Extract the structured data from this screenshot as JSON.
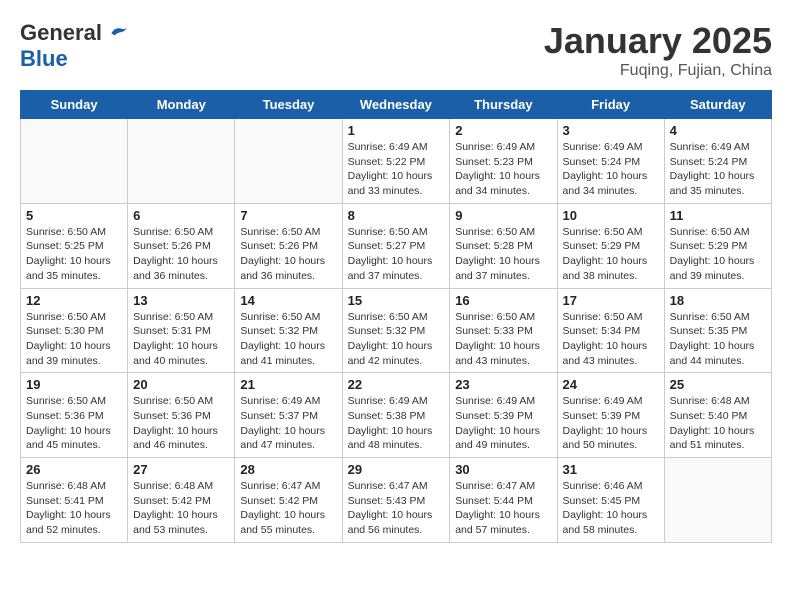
{
  "header": {
    "logo_general": "General",
    "logo_blue": "Blue",
    "title": "January 2025",
    "subtitle": "Fuqing, Fujian, China"
  },
  "weekdays": [
    "Sunday",
    "Monday",
    "Tuesday",
    "Wednesday",
    "Thursday",
    "Friday",
    "Saturday"
  ],
  "weeks": [
    [
      {
        "day": "",
        "info": ""
      },
      {
        "day": "",
        "info": ""
      },
      {
        "day": "",
        "info": ""
      },
      {
        "day": "1",
        "info": "Sunrise: 6:49 AM\nSunset: 5:22 PM\nDaylight: 10 hours and 33 minutes."
      },
      {
        "day": "2",
        "info": "Sunrise: 6:49 AM\nSunset: 5:23 PM\nDaylight: 10 hours and 34 minutes."
      },
      {
        "day": "3",
        "info": "Sunrise: 6:49 AM\nSunset: 5:24 PM\nDaylight: 10 hours and 34 minutes."
      },
      {
        "day": "4",
        "info": "Sunrise: 6:49 AM\nSunset: 5:24 PM\nDaylight: 10 hours and 35 minutes."
      }
    ],
    [
      {
        "day": "5",
        "info": "Sunrise: 6:50 AM\nSunset: 5:25 PM\nDaylight: 10 hours and 35 minutes."
      },
      {
        "day": "6",
        "info": "Sunrise: 6:50 AM\nSunset: 5:26 PM\nDaylight: 10 hours and 36 minutes."
      },
      {
        "day": "7",
        "info": "Sunrise: 6:50 AM\nSunset: 5:26 PM\nDaylight: 10 hours and 36 minutes."
      },
      {
        "day": "8",
        "info": "Sunrise: 6:50 AM\nSunset: 5:27 PM\nDaylight: 10 hours and 37 minutes."
      },
      {
        "day": "9",
        "info": "Sunrise: 6:50 AM\nSunset: 5:28 PM\nDaylight: 10 hours and 37 minutes."
      },
      {
        "day": "10",
        "info": "Sunrise: 6:50 AM\nSunset: 5:29 PM\nDaylight: 10 hours and 38 minutes."
      },
      {
        "day": "11",
        "info": "Sunrise: 6:50 AM\nSunset: 5:29 PM\nDaylight: 10 hours and 39 minutes."
      }
    ],
    [
      {
        "day": "12",
        "info": "Sunrise: 6:50 AM\nSunset: 5:30 PM\nDaylight: 10 hours and 39 minutes."
      },
      {
        "day": "13",
        "info": "Sunrise: 6:50 AM\nSunset: 5:31 PM\nDaylight: 10 hours and 40 minutes."
      },
      {
        "day": "14",
        "info": "Sunrise: 6:50 AM\nSunset: 5:32 PM\nDaylight: 10 hours and 41 minutes."
      },
      {
        "day": "15",
        "info": "Sunrise: 6:50 AM\nSunset: 5:32 PM\nDaylight: 10 hours and 42 minutes."
      },
      {
        "day": "16",
        "info": "Sunrise: 6:50 AM\nSunset: 5:33 PM\nDaylight: 10 hours and 43 minutes."
      },
      {
        "day": "17",
        "info": "Sunrise: 6:50 AM\nSunset: 5:34 PM\nDaylight: 10 hours and 43 minutes."
      },
      {
        "day": "18",
        "info": "Sunrise: 6:50 AM\nSunset: 5:35 PM\nDaylight: 10 hours and 44 minutes."
      }
    ],
    [
      {
        "day": "19",
        "info": "Sunrise: 6:50 AM\nSunset: 5:36 PM\nDaylight: 10 hours and 45 minutes."
      },
      {
        "day": "20",
        "info": "Sunrise: 6:50 AM\nSunset: 5:36 PM\nDaylight: 10 hours and 46 minutes."
      },
      {
        "day": "21",
        "info": "Sunrise: 6:49 AM\nSunset: 5:37 PM\nDaylight: 10 hours and 47 minutes."
      },
      {
        "day": "22",
        "info": "Sunrise: 6:49 AM\nSunset: 5:38 PM\nDaylight: 10 hours and 48 minutes."
      },
      {
        "day": "23",
        "info": "Sunrise: 6:49 AM\nSunset: 5:39 PM\nDaylight: 10 hours and 49 minutes."
      },
      {
        "day": "24",
        "info": "Sunrise: 6:49 AM\nSunset: 5:39 PM\nDaylight: 10 hours and 50 minutes."
      },
      {
        "day": "25",
        "info": "Sunrise: 6:48 AM\nSunset: 5:40 PM\nDaylight: 10 hours and 51 minutes."
      }
    ],
    [
      {
        "day": "26",
        "info": "Sunrise: 6:48 AM\nSunset: 5:41 PM\nDaylight: 10 hours and 52 minutes."
      },
      {
        "day": "27",
        "info": "Sunrise: 6:48 AM\nSunset: 5:42 PM\nDaylight: 10 hours and 53 minutes."
      },
      {
        "day": "28",
        "info": "Sunrise: 6:47 AM\nSunset: 5:42 PM\nDaylight: 10 hours and 55 minutes."
      },
      {
        "day": "29",
        "info": "Sunrise: 6:47 AM\nSunset: 5:43 PM\nDaylight: 10 hours and 56 minutes."
      },
      {
        "day": "30",
        "info": "Sunrise: 6:47 AM\nSunset: 5:44 PM\nDaylight: 10 hours and 57 minutes."
      },
      {
        "day": "31",
        "info": "Sunrise: 6:46 AM\nSunset: 5:45 PM\nDaylight: 10 hours and 58 minutes."
      },
      {
        "day": "",
        "info": ""
      }
    ]
  ]
}
